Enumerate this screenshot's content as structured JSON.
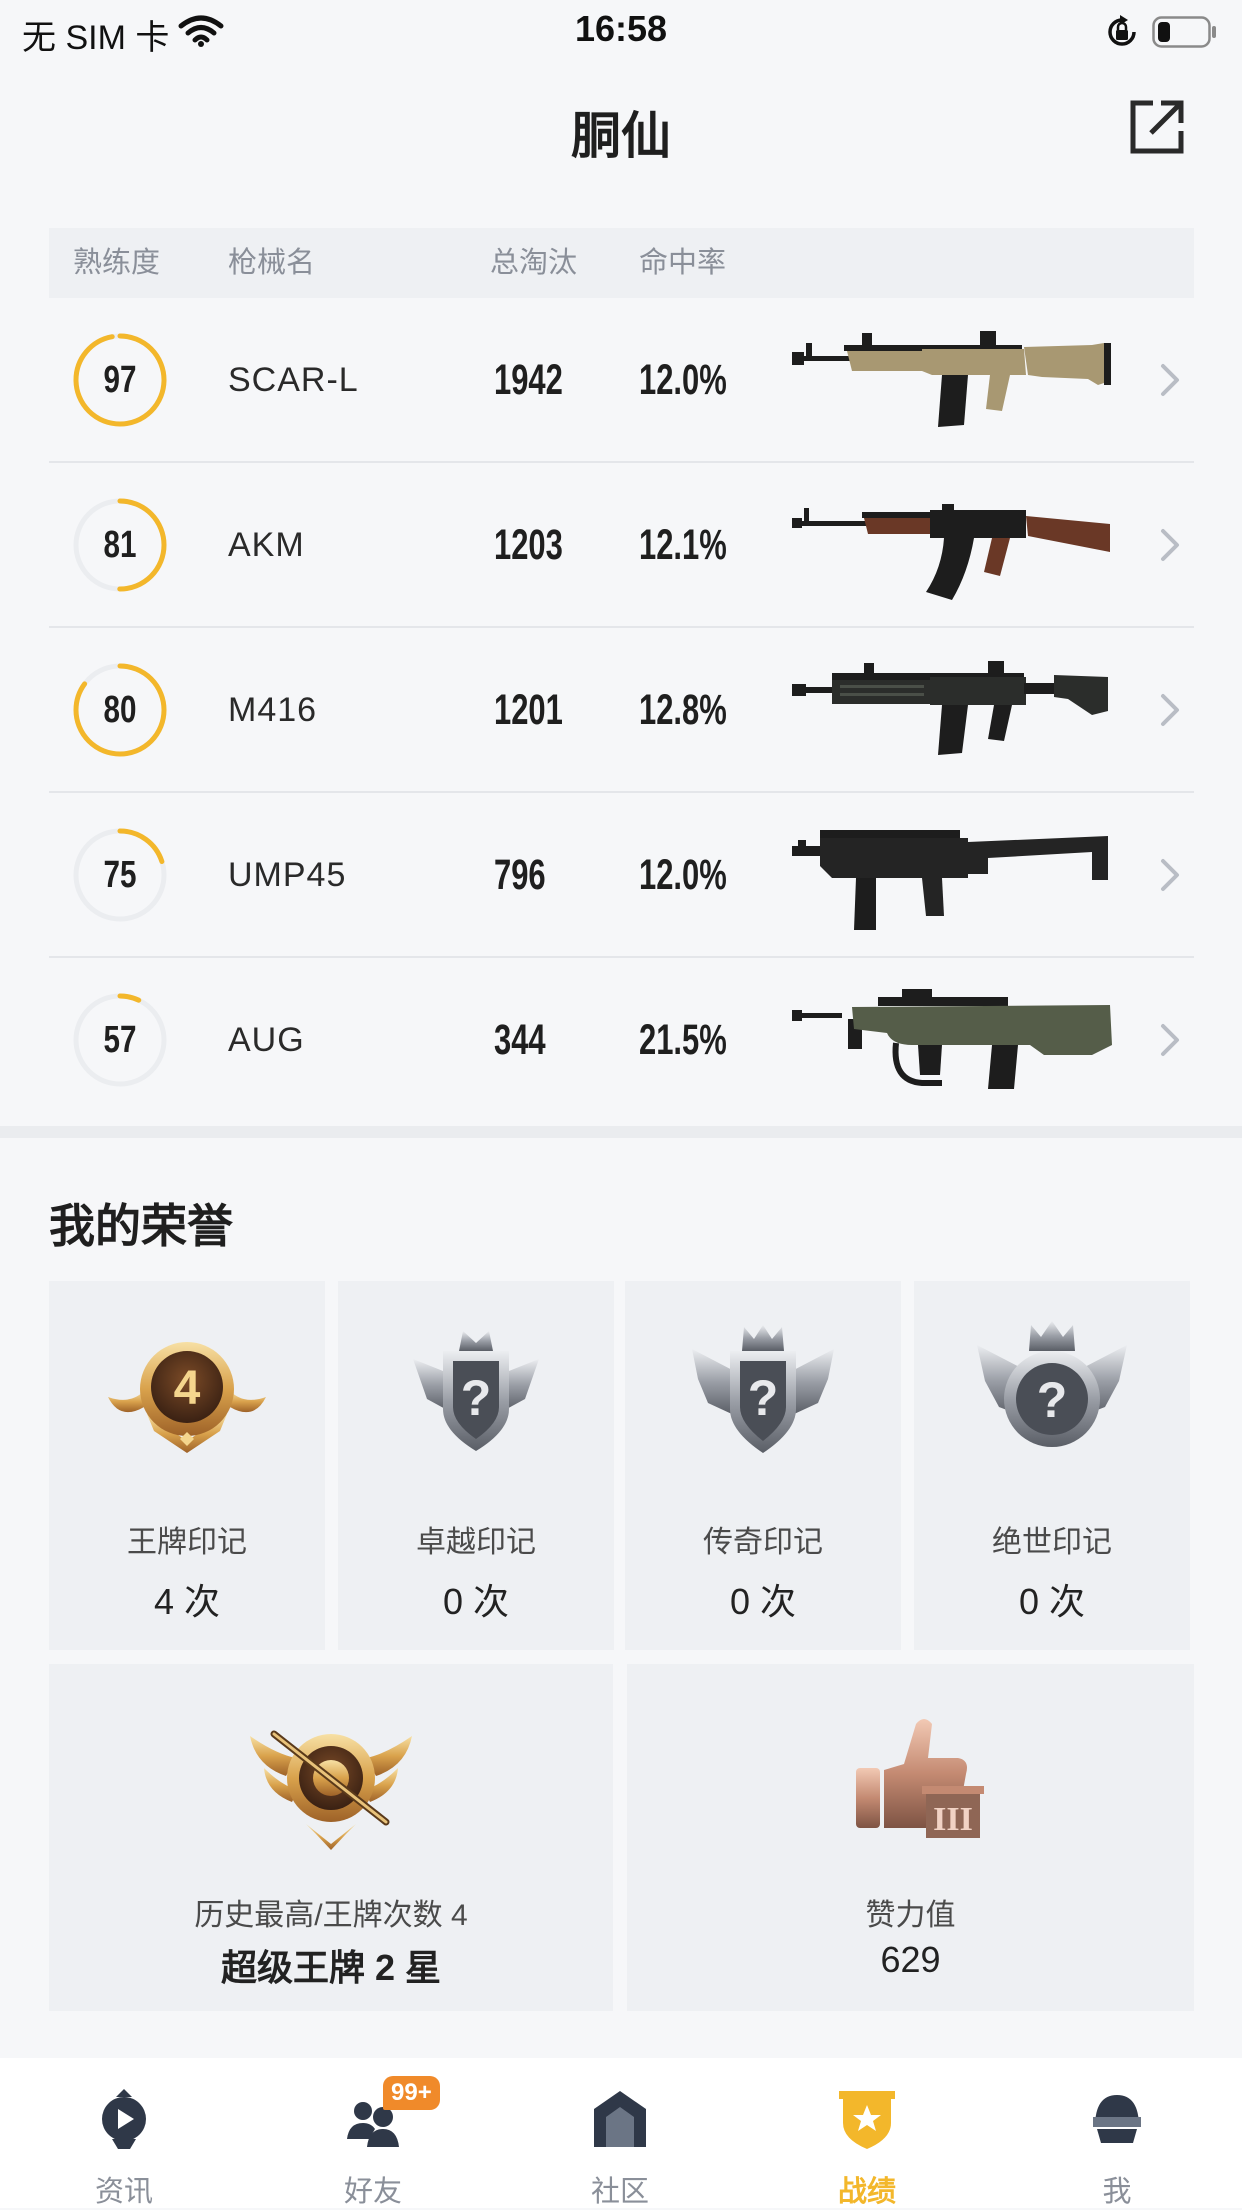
{
  "status_bar": {
    "carrier": "无 SIM 卡",
    "time": "16:58",
    "icons": [
      "wifi-icon",
      "orientation-lock-icon",
      "battery-icon"
    ],
    "battery_level": 0.25
  },
  "header": {
    "title": "胴仙",
    "action_icon": "share-icon"
  },
  "weapon_table": {
    "columns": {
      "proficiency": "熟练度",
      "name": "枪械名",
      "kills": "总淘汰",
      "hit_rate": "命中率"
    },
    "ring_color": "#f3b72b",
    "ring_track_color": "#ebedf0",
    "rows": [
      {
        "proficiency": "97",
        "proficiency_fill": 0.97,
        "name": "SCAR-L",
        "kills": "1942",
        "hit_rate": "12.0%",
        "gun_icon": "scar-l",
        "gun_color": "#a89872"
      },
      {
        "proficiency": "81",
        "proficiency_fill": 0.5,
        "name": "AKM",
        "kills": "1203",
        "hit_rate": "12.1%",
        "gun_icon": "akm",
        "gun_color": "#6a3826"
      },
      {
        "proficiency": "80",
        "proficiency_fill": 0.85,
        "name": "M416",
        "kills": "1201",
        "hit_rate": "12.8%",
        "gun_icon": "m416",
        "gun_color": "#2b2d2b"
      },
      {
        "proficiency": "75",
        "proficiency_fill": 0.2,
        "name": "UMP45",
        "kills": "796",
        "hit_rate": "12.0%",
        "gun_icon": "ump45",
        "gun_color": "#242424"
      },
      {
        "proficiency": "57",
        "proficiency_fill": 0.07,
        "name": "AUG",
        "kills": "344",
        "hit_rate": "21.5%",
        "gun_icon": "aug",
        "gun_color": "#555d49"
      }
    ]
  },
  "honors": {
    "title": "我的荣誉",
    "marks": [
      {
        "label": "王牌印记",
        "count": "4 次",
        "badge_icon": "ace-mark-badge",
        "badge_glyph": "4"
      },
      {
        "label": "卓越印记",
        "count": "0 次",
        "badge_icon": "excellence-mark-badge-locked",
        "badge_glyph": "?"
      },
      {
        "label": "传奇印记",
        "count": "0 次",
        "badge_icon": "legend-mark-badge-locked",
        "badge_glyph": "?"
      },
      {
        "label": "绝世印记",
        "count": "0 次",
        "badge_icon": "peerless-mark-badge-locked",
        "badge_glyph": "?"
      }
    ],
    "best": {
      "label": "历史最高/王牌次数 4",
      "value": "超级王牌 2 星",
      "badge_icon": "super-ace-emblem"
    },
    "popularity": {
      "label": "赞力值",
      "value": "629",
      "badge_icon": "thumbs-up-badge",
      "badge_glyph": "III"
    }
  },
  "tab_bar": {
    "active_color": "#f3b72b",
    "tabs": [
      {
        "label": "资讯",
        "icon": "news-icon"
      },
      {
        "label": "好友",
        "icon": "friends-icon",
        "badge": "99+"
      },
      {
        "label": "社区",
        "icon": "community-icon"
      },
      {
        "label": "战绩",
        "icon": "record-icon",
        "active": true
      },
      {
        "label": "我",
        "icon": "helmet-icon"
      }
    ]
  }
}
